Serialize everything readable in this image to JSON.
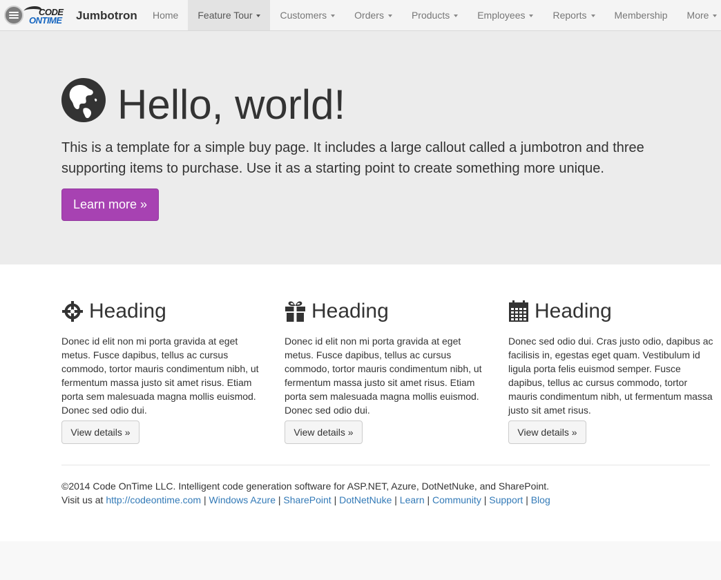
{
  "navbar": {
    "logo_line1": "CODE",
    "logo_line2": "ONTIME",
    "brand": "Jumbotron",
    "items": [
      {
        "label": "Home",
        "dropdown": false,
        "active": false
      },
      {
        "label": "Feature Tour",
        "dropdown": true,
        "active": true
      },
      {
        "label": "Customers",
        "dropdown": true,
        "active": false
      },
      {
        "label": "Orders",
        "dropdown": true,
        "active": false
      },
      {
        "label": "Products",
        "dropdown": true,
        "active": false
      },
      {
        "label": "Employees",
        "dropdown": true,
        "active": false
      },
      {
        "label": "Reports",
        "dropdown": true,
        "active": false
      },
      {
        "label": "Membership",
        "dropdown": false,
        "active": false
      },
      {
        "label": "More",
        "dropdown": true,
        "active": false
      }
    ]
  },
  "jumbotron": {
    "icon": "globe-icon",
    "title": "Hello, world!",
    "text": "This is a template for a simple buy page. It includes a large callout called a jumbotron and three supporting items to purchase. Use it as a starting point to create something more unique.",
    "button_label": "Learn more »",
    "button_color": "#a742b2"
  },
  "columns": [
    {
      "icon": "crosshair-icon",
      "heading": "Heading",
      "text": "Donec id elit non mi porta gravida at eget metus. Fusce dapibus, tellus ac cursus commodo, tortor mauris condimentum nibh, ut fermentum massa justo sit amet risus. Etiam porta sem malesuada magna mollis euismod. Donec sed odio dui.",
      "button_label": "View details »"
    },
    {
      "icon": "gift-icon",
      "heading": "Heading",
      "text": "Donec id elit non mi porta gravida at eget metus. Fusce dapibus, tellus ac cursus commodo, tortor mauris condimentum nibh, ut fermentum massa justo sit amet risus. Etiam porta sem malesuada magna mollis euismod. Donec sed odio dui.",
      "button_label": "View details »"
    },
    {
      "icon": "calendar-icon",
      "heading": "Heading",
      "text": "Donec sed odio dui. Cras justo odio, dapibus ac facilisis in, egestas eget quam. Vestibulum id ligula porta felis euismod semper. Fusce dapibus, tellus ac cursus commodo, tortor mauris condimentum nibh, ut fermentum massa justo sit amet risus.",
      "button_label": "View details »"
    }
  ],
  "footer": {
    "copyright": "©2014 Code OnTime LLC. Intelligent code generation software for ASP.NET, Azure, DotNetNuke, and SharePoint.",
    "visit_prefix": "Visit us at",
    "links": [
      "http://codeontime.com",
      "Windows Azure",
      "SharePoint",
      "DotNetNuke",
      "Learn",
      "Community",
      "Support",
      "Blog"
    ],
    "separator": "|"
  }
}
